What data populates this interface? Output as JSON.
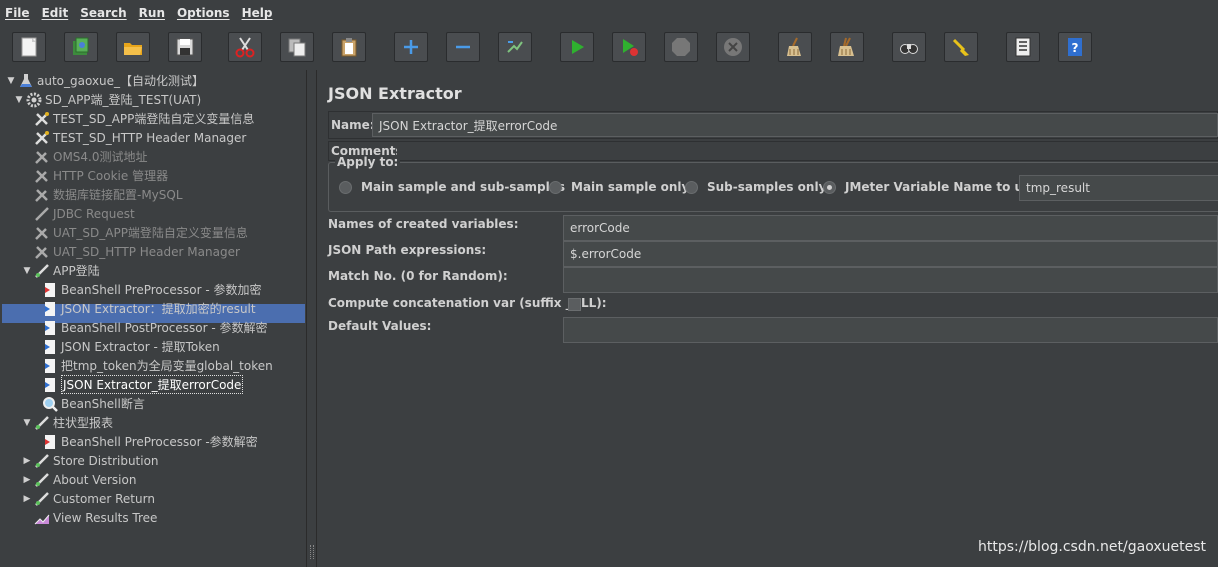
{
  "menu": [
    "File",
    "Edit",
    "Search",
    "Run",
    "Options",
    "Help"
  ],
  "toolbar": {
    "icons": [
      "new-icon",
      "templates-icon",
      "open-icon",
      "save-icon",
      "cut-icon",
      "copy-icon",
      "paste-icon",
      "expand-icon",
      "collapse-icon",
      "toggle-icon",
      "start-icon",
      "start-no-pause-icon",
      "stop-icon",
      "shutdown-icon",
      "clear-icon",
      "clear-all-icon",
      "search-icon",
      "reset-search-icon",
      "function-helper-icon",
      "help-icon"
    ]
  },
  "tree": {
    "items": [
      {
        "label": "auto_gaoxue_【自动化测试】",
        "icon": "test-plan-icon"
      },
      {
        "label": "SD_APP端_登陆_TEST(UAT)",
        "icon": "thread-group-icon"
      },
      {
        "label": "TEST_SD_APP端登陆自定义变量信息",
        "icon": "config-icon"
      },
      {
        "label": "TEST_SD_HTTP Header Manager",
        "icon": "config-icon"
      },
      {
        "label": "OMS4.0测试地址",
        "icon": "config-icon"
      },
      {
        "label": "HTTP Cookie 管理器",
        "icon": "config-icon"
      },
      {
        "label": "数据库链接配置-MySQL",
        "icon": "config-icon"
      },
      {
        "label": "JDBC Request",
        "icon": "sampler-icon"
      },
      {
        "label": "UAT_SD_APP端登陆自定义变量信息",
        "icon": "config-icon"
      },
      {
        "label": "UAT_SD_HTTP Header Manager",
        "icon": "config-icon"
      },
      {
        "label": "APP登陆",
        "icon": "sampler-icon"
      },
      {
        "label": "BeanShell PreProcessor - 参数加密",
        "icon": "preprocessor-icon"
      },
      {
        "label": "JSON Extractor：提取加密的result",
        "icon": "postprocessor-icon"
      },
      {
        "label": "BeanShell PostProcessor - 参数解密",
        "icon": "postprocessor-icon"
      },
      {
        "label": "JSON Extractor - 提取Token",
        "icon": "postprocessor-icon"
      },
      {
        "label": "把tmp_token为全局变量global_token",
        "icon": "postprocessor-icon"
      },
      {
        "label": "JSON Extractor_提取errorCode",
        "icon": "postprocessor-icon"
      },
      {
        "label": "BeanShell断言",
        "icon": "assertion-icon"
      },
      {
        "label": "柱状型报表",
        "icon": "sampler-icon"
      },
      {
        "label": "BeanShell PreProcessor -参数解密",
        "icon": "preprocessor-icon"
      },
      {
        "label": "Store Distribution",
        "icon": "sampler-icon"
      },
      {
        "label": "About Version",
        "icon": "sampler-icon"
      },
      {
        "label": "Customer Return",
        "icon": "sampler-icon"
      },
      {
        "label": "View Results Tree",
        "icon": "listener-icon"
      }
    ]
  },
  "panel": {
    "title": "JSON Extractor",
    "name_label": "Name:",
    "name_value": "JSON Extractor_提取errorCode",
    "comments_label": "Comments:",
    "apply_to_label": "Apply to:",
    "apply_options": [
      "Main sample and sub-samples",
      "Main sample only",
      "Sub-samples only",
      "JMeter Variable Name to use"
    ],
    "selected_option": "JMeter Variable Name to use",
    "jmeter_var_value": "tmp_result",
    "names_label": "Names of created variables:",
    "names_value": "errorCode",
    "json_path_label": "JSON Path expressions:",
    "json_path_value": "$.errorCode",
    "match_no_label": "Match No. (0 for Random):",
    "match_no_value": "",
    "concat_label": "Compute concatenation var (suffix _ALL):",
    "default_label": "Default Values:",
    "default_value": ""
  },
  "watermark": "https://blog.csdn.net/gaoxuetest"
}
